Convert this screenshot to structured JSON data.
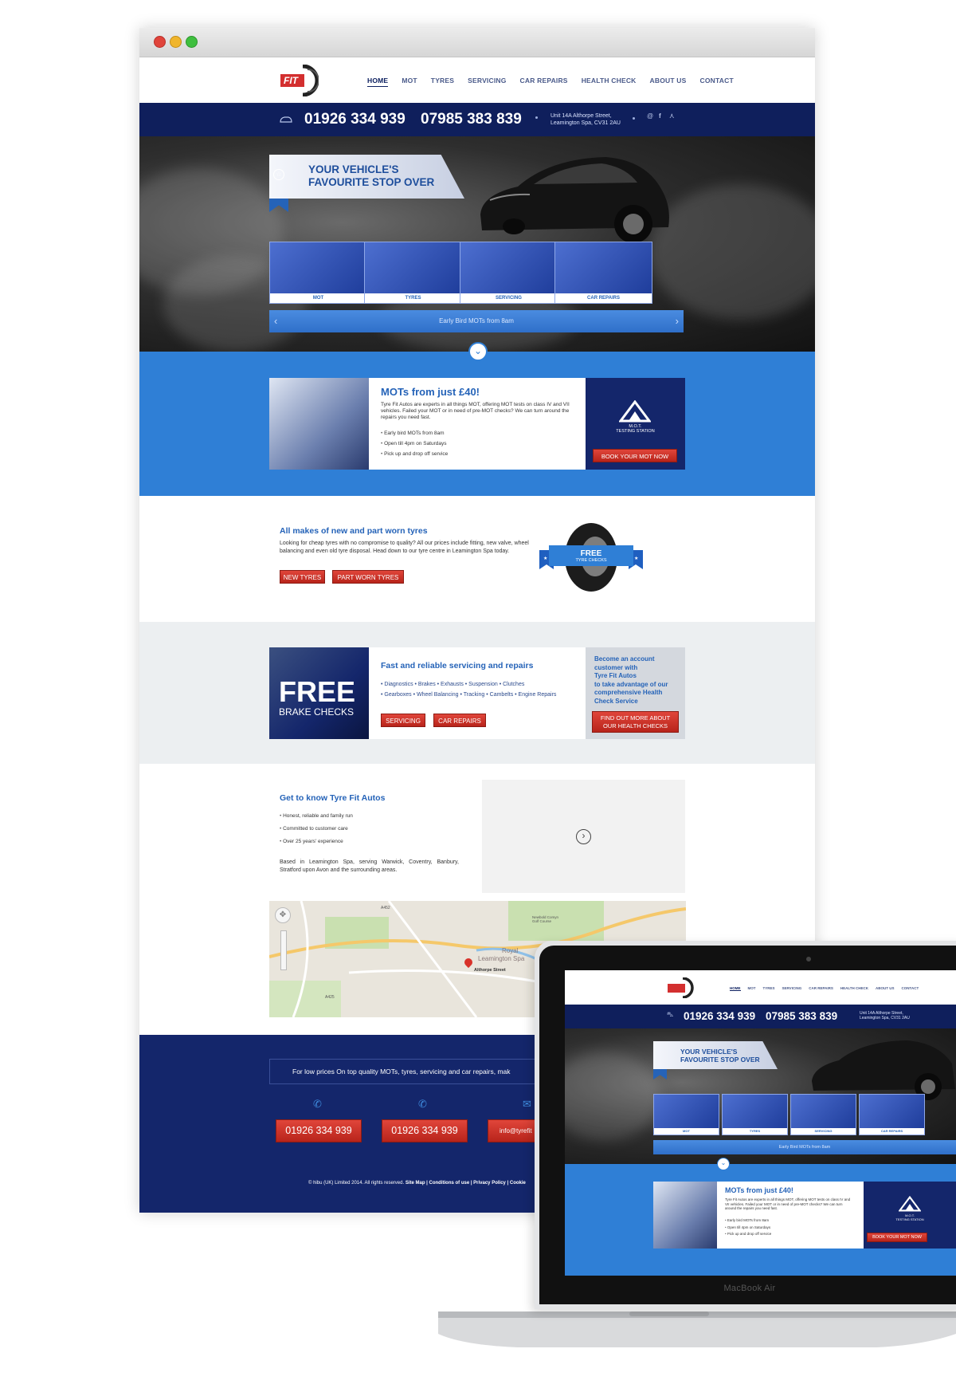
{
  "browser": {
    "dots": [
      "#e0443b",
      "#f0b52c",
      "#3fbf3f"
    ]
  },
  "header": {
    "logo_text": "FIT",
    "nav": [
      "HOME",
      "MOT",
      "TYRES",
      "SERVICING",
      "CAR REPAIRS",
      "HEALTH CHECK",
      "ABOUT US",
      "CONTACT"
    ],
    "active_nav": "HOME"
  },
  "topbar": {
    "phone1": "01926 334 939",
    "phone2": "07985 383 839",
    "address_line1": "Unit 14A Althorpe Street,",
    "address_line2": "Leamington Spa, CV31 2AU",
    "icons": [
      "car-icon",
      "email-icon",
      "facebook-icon",
      "share-icon"
    ]
  },
  "hero": {
    "ribbon_line1": "YOUR VEHICLE'S",
    "ribbon_line2": "FAVOURITE STOP OVER",
    "tiles": [
      "MOT",
      "TYRES",
      "SERVICING",
      "CAR REPAIRS"
    ],
    "slider_text": "Early Bird MOTs from 8am"
  },
  "mot": {
    "title": "MOTs from just £40!",
    "body": "Tyre Fit Autos are experts in all things MOT, offering MOT tests on class IV and VII vehicles. Failed your MOT or in need of pre-MOT checks? We can turn around the repairs you need fast.",
    "bullets": [
      "Early bird MOTs from 8am",
      "Open till 4pm on Saturdays",
      "Pick up and drop off service"
    ],
    "badge_line1": "M.O.T.",
    "badge_line2": "TESTING STATION",
    "button": "BOOK YOUR MOT NOW"
  },
  "tyres": {
    "title": "All makes of new and part worn tyres",
    "body": "Looking for cheap tyres with no compromise to quality? All our prices include fitting, new valve, wheel balancing and even old tyre disposal. Head down to our tyre centre in Leamington Spa today.",
    "btn1": "NEW TYRES",
    "btn2": "PART WORN TYRES",
    "banner_line1": "FREE",
    "banner_line2": "TYRE CHECKS"
  },
  "service": {
    "free": "FREE",
    "brake": "BRAKE CHECKS",
    "title": "Fast and reliable servicing and repairs",
    "line1": "• Diagnostics  • Brakes  • Exhausts  • Suspension  • Clutches",
    "line2": "• Gearboxes  • Wheel Balancing  • Tracking  • Cambelts  • Engine Repairs",
    "btn1": "SERVICING",
    "btn2": "CAR REPAIRS",
    "account_lines": [
      "Become an account",
      "customer with",
      "Tyre Fit Autos",
      "to take advantage of our",
      "comprehensive Health",
      "Check Service"
    ],
    "account_btn1": "FIND OUT MORE ABOUT",
    "account_btn2": "OUR HEALTH CHECKS"
  },
  "about": {
    "title": "Get to know Tyre Fit Autos",
    "bullets": [
      "Honest, reliable and family run",
      "Committed to customer care",
      "Over 25 years' experience"
    ],
    "body": "Based in Leamington Spa, serving Warwick, Coventry, Banbury, Stratford upon Avon and the surrounding areas."
  },
  "map": {
    "labels": [
      "Royal",
      "Leamington Spa",
      "Althorpe Street",
      "Newbold Comyn Golf Course",
      "A425",
      "A452"
    ]
  },
  "footer": {
    "tagline": "For low prices On top quality MOTs, tyres, servicing and car repairs, mak",
    "phone1": "01926 334 939",
    "phone2": "01926 334 939",
    "email": "info@tyrefit",
    "copyright": "© hibu (UK) Limited 2014. All rights reserved.",
    "links": "Site Map | Conditions of use | Privacy Policy | Cookie"
  },
  "laptop": {
    "brand": "MacBook Air",
    "nav": [
      "HOME",
      "MOT",
      "TYRES",
      "SERVICING",
      "CAR REPAIRS",
      "HEALTH CHECK",
      "ABOUT US",
      "CONTACT"
    ],
    "phone1": "01926 334 939",
    "phone2": "07985 383 839",
    "address_line1": "Unit 14A Althorpe Street,",
    "address_line2": "Leamington Spa, CV31 2AU",
    "ribbon_line1": "YOUR VEHICLE'S",
    "ribbon_line2": "FAVOURITE STOP OVER",
    "tiles": [
      "MOT",
      "TYRES",
      "SERVICING",
      "CAR REPAIRS"
    ],
    "slider_text": "Early Bird MOTs from 8am",
    "mot_title": "MOTs from just £40!",
    "mot_body": "Tyre Fit Autos are experts in all things MOT, offering MOT tests on class IV and VII vehicles. Failed your MOT or in need of pre-MOT checks? We can turn around the repairs you need fast.",
    "mot_bullets": [
      "Early bird MOTs from 8am",
      "Open till 4pm on Saturdays",
      "Pick up and drop off service"
    ],
    "badge_line1": "M.O.T.",
    "badge_line2": "TESTING STATION",
    "mot_button": "BOOK YOUR MOT NOW"
  }
}
